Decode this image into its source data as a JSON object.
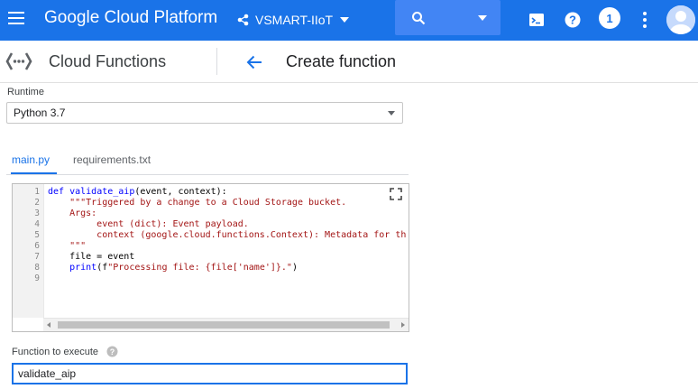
{
  "topbar": {
    "app_title": "Google Cloud Platform",
    "project_name": "VSMART-IIoT",
    "notification_count": "1",
    "colors": {
      "bar": "#1a73e8",
      "search": "#4285f4"
    },
    "icons": [
      "menu-icon",
      "project-dots-icon",
      "chevron-down-icon",
      "search-icon",
      "cloud-shell-icon",
      "help-icon",
      "more-vert-icon",
      "avatar"
    ]
  },
  "subheader": {
    "product": "Cloud Functions",
    "page_title": "Create function"
  },
  "runtime": {
    "label": "Runtime",
    "value": "Python 3.7"
  },
  "tabs": [
    {
      "label": "main.py",
      "active": true
    },
    {
      "label": "requirements.txt",
      "active": false
    }
  ],
  "editor": {
    "line_numbers": [
      "1",
      "2",
      "3",
      "4",
      "5",
      "6",
      "7",
      "8",
      "9"
    ],
    "lines": [
      [
        {
          "t": "def ",
          "c": "kw"
        },
        {
          "t": "validate_aip",
          "c": "fn"
        },
        {
          "t": "(event, context):",
          "c": ""
        }
      ],
      [
        {
          "t": "    \"\"\"Triggered by a change to a Cloud Storage bucket.",
          "c": "str"
        }
      ],
      [
        {
          "t": "    Args:",
          "c": "str"
        }
      ],
      [
        {
          "t": "         event (dict): Event payload.",
          "c": "str"
        }
      ],
      [
        {
          "t": "         context (google.cloud.functions.Context): Metadata for th",
          "c": "str"
        }
      ],
      [
        {
          "t": "    \"\"\"",
          "c": "str"
        }
      ],
      [
        {
          "t": "    file = event",
          "c": ""
        }
      ],
      [
        {
          "t": "    ",
          "c": ""
        },
        {
          "t": "print",
          "c": "kw"
        },
        {
          "t": "(f",
          "c": ""
        },
        {
          "t": "\"Processing file: {file['name']}.\"",
          "c": "str"
        },
        {
          "t": ")",
          "c": ""
        }
      ],
      [
        {
          "t": "",
          "c": ""
        }
      ]
    ]
  },
  "function_to_execute": {
    "label": "Function to execute",
    "value": "validate_aip"
  }
}
